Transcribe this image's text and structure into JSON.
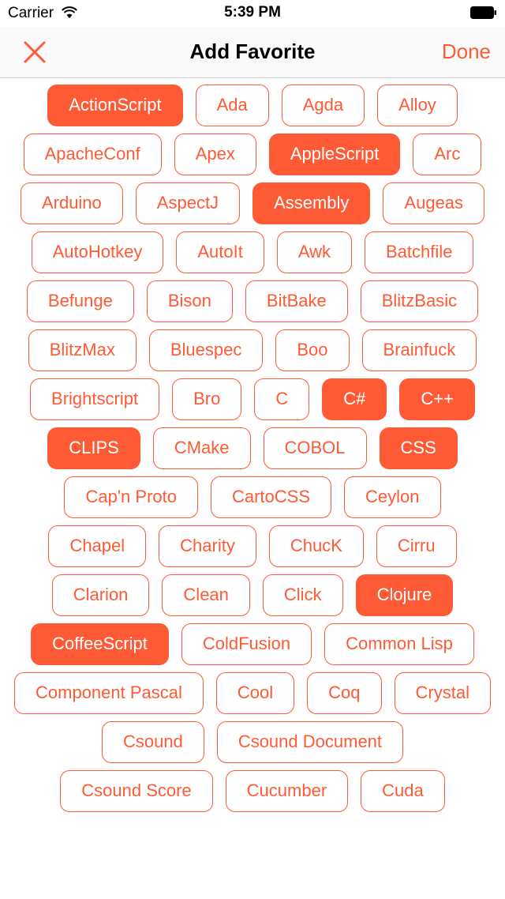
{
  "status_bar": {
    "carrier": "Carrier",
    "time": "5:39 PM"
  },
  "nav": {
    "title": "Add Favorite",
    "done_label": "Done"
  },
  "accent_color": "#ff5a36",
  "tags": [
    [
      {
        "label": "ActionScript",
        "selected": true
      },
      {
        "label": "Ada",
        "selected": false
      },
      {
        "label": "Agda",
        "selected": false
      },
      {
        "label": "Alloy",
        "selected": false
      }
    ],
    [
      {
        "label": "ApacheConf",
        "selected": false
      },
      {
        "label": "Apex",
        "selected": false
      },
      {
        "label": "AppleScript",
        "selected": true
      },
      {
        "label": "Arc",
        "selected": false
      }
    ],
    [
      {
        "label": "Arduino",
        "selected": false
      },
      {
        "label": "AspectJ",
        "selected": false
      },
      {
        "label": "Assembly",
        "selected": true
      },
      {
        "label": "Augeas",
        "selected": false
      }
    ],
    [
      {
        "label": "AutoHotkey",
        "selected": false
      },
      {
        "label": "AutoIt",
        "selected": false
      },
      {
        "label": "Awk",
        "selected": false
      },
      {
        "label": "Batchfile",
        "selected": false
      }
    ],
    [
      {
        "label": "Befunge",
        "selected": false
      },
      {
        "label": "Bison",
        "selected": false
      },
      {
        "label": "BitBake",
        "selected": false
      },
      {
        "label": "BlitzBasic",
        "selected": false
      }
    ],
    [
      {
        "label": "BlitzMax",
        "selected": false
      },
      {
        "label": "Bluespec",
        "selected": false
      },
      {
        "label": "Boo",
        "selected": false
      },
      {
        "label": "Brainfuck",
        "selected": false
      }
    ],
    [
      {
        "label": "Brightscript",
        "selected": false
      },
      {
        "label": "Bro",
        "selected": false
      },
      {
        "label": "C",
        "selected": false
      },
      {
        "label": "C#",
        "selected": true
      },
      {
        "label": "C++",
        "selected": true
      }
    ],
    [
      {
        "label": "CLIPS",
        "selected": true
      },
      {
        "label": "CMake",
        "selected": false
      },
      {
        "label": "COBOL",
        "selected": false
      },
      {
        "label": "CSS",
        "selected": true
      }
    ],
    [
      {
        "label": "Cap'n Proto",
        "selected": false
      },
      {
        "label": "CartoCSS",
        "selected": false
      },
      {
        "label": "Ceylon",
        "selected": false
      }
    ],
    [
      {
        "label": "Chapel",
        "selected": false
      },
      {
        "label": "Charity",
        "selected": false
      },
      {
        "label": "ChucK",
        "selected": false
      },
      {
        "label": "Cirru",
        "selected": false
      }
    ],
    [
      {
        "label": "Clarion",
        "selected": false
      },
      {
        "label": "Clean",
        "selected": false
      },
      {
        "label": "Click",
        "selected": false
      },
      {
        "label": "Clojure",
        "selected": true
      }
    ],
    [
      {
        "label": "CoffeeScript",
        "selected": true
      },
      {
        "label": "ColdFusion",
        "selected": false
      },
      {
        "label": "Common Lisp",
        "selected": false
      }
    ],
    [
      {
        "label": "Component Pascal",
        "selected": false
      },
      {
        "label": "Cool",
        "selected": false
      },
      {
        "label": "Coq",
        "selected": false
      },
      {
        "label": "Crystal",
        "selected": false
      }
    ],
    [
      {
        "label": "Csound",
        "selected": false
      },
      {
        "label": "Csound Document",
        "selected": false
      }
    ],
    [
      {
        "label": "Csound Score",
        "selected": false
      },
      {
        "label": "Cucumber",
        "selected": false
      },
      {
        "label": "Cuda",
        "selected": false
      }
    ]
  ]
}
